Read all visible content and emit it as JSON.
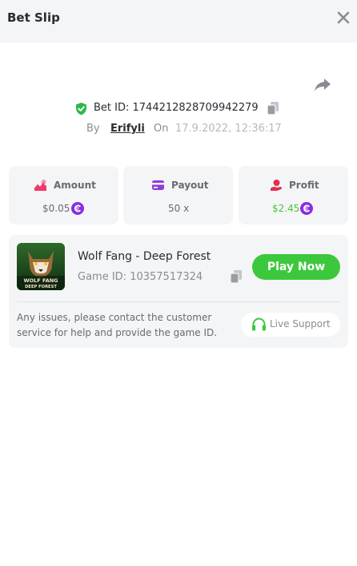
{
  "header": {
    "title": "Bet Slip"
  },
  "bet": {
    "id_text": "Bet ID: 1744212828709942279",
    "by_label": "By",
    "user": "Erifyli",
    "on_label": "On",
    "datetime": "17.9.2022, 12:36:17"
  },
  "stats": {
    "amount": {
      "label": "Amount",
      "value": "$0.05"
    },
    "payout": {
      "label": "Payout",
      "value": "50 x"
    },
    "profit": {
      "label": "Profit",
      "value": "$2.45"
    }
  },
  "game": {
    "name": "Wolf Fang - Deep Forest",
    "id_text": "Game ID: 10357517324",
    "thumb_title": "WOLF FANG",
    "thumb_subtitle": "DEEP FOREST",
    "play_label": "Play Now"
  },
  "support": {
    "notice": "Any issues, please contact the customer service for help and provide the game ID.",
    "button_label": "Live Support"
  },
  "colors": {
    "accent_green": "#3cc83c",
    "coin_purple": "#8a2be2",
    "icon_pink": "#ee3a6a",
    "icon_purple": "#8c40d8",
    "icon_red": "#e0304a",
    "profit_green": "#4cc43a"
  },
  "icons": [
    "close-icon",
    "share-icon",
    "shield-check-icon",
    "copy-icon",
    "rising-chart-icon",
    "wallet-card-icon",
    "money-hand-icon",
    "coin-icon",
    "headset-icon"
  ]
}
